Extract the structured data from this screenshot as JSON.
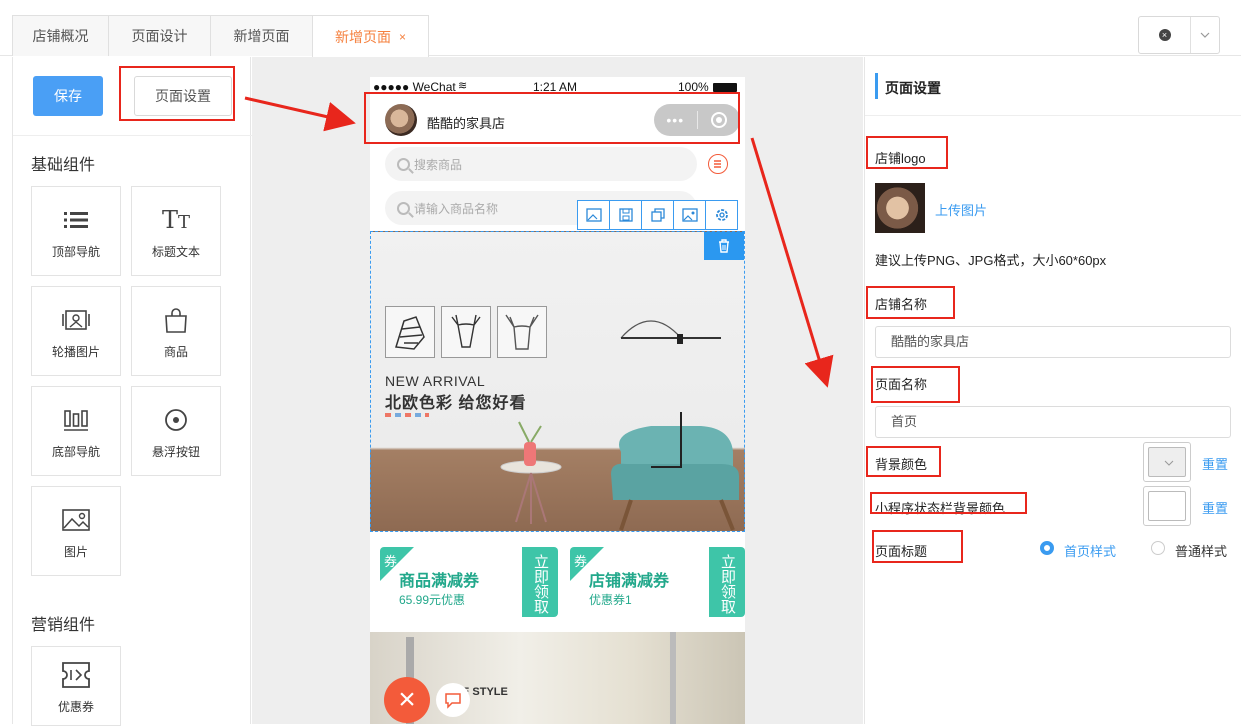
{
  "tabs": [
    {
      "label": "店铺概况"
    },
    {
      "label": "页面设计"
    },
    {
      "label": "新增页面"
    },
    {
      "label": "新增页面",
      "close": "×"
    }
  ],
  "left": {
    "save": "保存",
    "page_settings": "页面设置",
    "basic_title": "基础组件",
    "basic": [
      {
        "label": "顶部导航",
        "icon": "list-icon"
      },
      {
        "label": "标题文本",
        "icon": "text-icon"
      },
      {
        "label": "轮播图片",
        "icon": "carousel-icon"
      },
      {
        "label": "商品",
        "icon": "bag-icon"
      },
      {
        "label": "底部导航",
        "icon": "bars-icon"
      },
      {
        "label": "悬浮按钮",
        "icon": "float-button-icon"
      },
      {
        "label": "图片",
        "icon": "image-icon"
      }
    ],
    "marketing_title": "营销组件",
    "marketing": [
      {
        "label": "优惠券",
        "icon": "coupon-icon"
      }
    ]
  },
  "phone": {
    "status": {
      "carrier": "●●●●● WeChat",
      "time": "1:21 AM",
      "battery": "100%"
    },
    "store_name": "酷酷的家具店",
    "capsule_dots": "•••",
    "search1_placeholder": "搜索商品",
    "search2_placeholder": "请输入商品名称",
    "banner": {
      "line1": "NEW ARRIVAL",
      "line2": "北欧色彩 给您好看"
    },
    "coupons": [
      {
        "tag": "券",
        "title": "商品满减券",
        "sub": "65.99元优惠",
        "action": "立即领取"
      },
      {
        "tag": "券",
        "title": "店铺满减券",
        "sub": "优惠券1",
        "action": "立即领取"
      }
    ],
    "room_text": "E STYLE"
  },
  "right": {
    "header": "页面设置",
    "logo_label": "店铺logo",
    "upload": "上传图片",
    "hint": "建议上传PNG、JPG格式，大小60*60px",
    "name_label": "店铺名称",
    "name_value": "酷酷的家具店",
    "page_name_label": "页面名称",
    "page_name_value": "首页",
    "bg_label": "背景颜色",
    "bg_color": "#eeeeee",
    "statusbar_label": "小程序状态栏背景颜色",
    "statusbar_color": "#ffffff",
    "reset": "重置",
    "title_label": "页面标题",
    "title_options": [
      {
        "label": "首页样式",
        "selected": true
      },
      {
        "label": "普通样式",
        "selected": false
      }
    ]
  },
  "colors": {
    "accent": "#3a9bf0",
    "tab_active": "#f5803e",
    "annotation": "#e8261c",
    "coupon": "#3ec5a8"
  }
}
